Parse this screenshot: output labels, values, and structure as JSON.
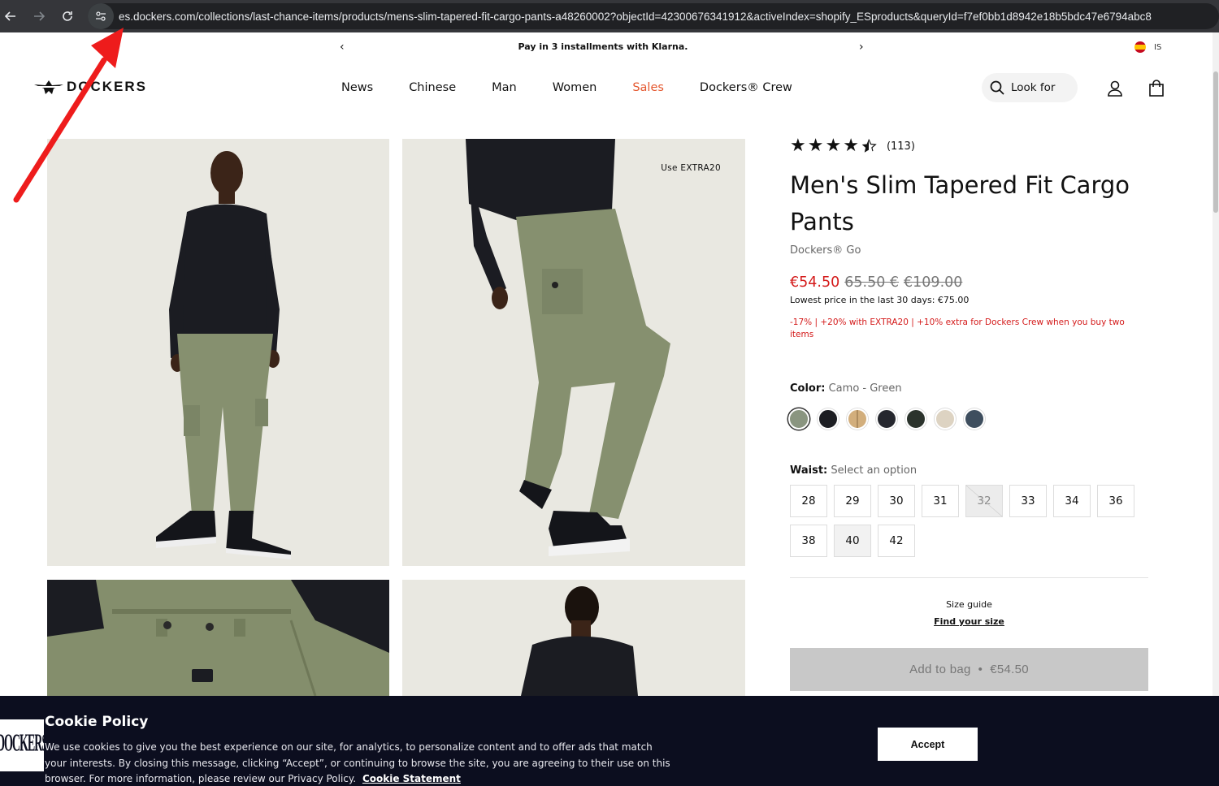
{
  "browser": {
    "back_icon": "arrow-left-icon",
    "forward_icon": "arrow-right-icon",
    "reload_icon": "reload-icon",
    "url": "es.dockers.com/collections/last-chance-items/products/mens-slim-tapered-fit-cargo-pants-a48260002?objectId=42300676341912&activeIndex=shopify_ESproducts&queryId=f7ef0bb1d8942e18b5bdc47e6794abc8"
  },
  "promo": {
    "prev": "‹",
    "text": "Pay in 3 installments with Klarna.",
    "next": "›",
    "lang": "IS"
  },
  "header": {
    "logo_text": "DOCKERS",
    "nav": [
      "News",
      "Chinese",
      "Man",
      "Women",
      "Sales",
      "Dockers® Crew"
    ],
    "search_label": "Look for"
  },
  "gallery": {
    "badge": "Use EXTRA20"
  },
  "product": {
    "rating": 4.5,
    "review_count": "(113)",
    "title": "Men's Slim Tapered Fit Cargo Pants",
    "sub_brand": "Dockers® Go",
    "price_now": "€54.50",
    "price_prev": "65.50 €",
    "price_orig": "€109.00",
    "lowest_price": "Lowest price in the last 30 days: €75.00",
    "promo_note": "-17% | +20% with EXTRA20 | +10% extra for Dockers Crew when you buy two items",
    "color_label": "Color:",
    "color_value": "Camo - Green",
    "colors": [
      "#8a9580",
      "#1c1d22",
      "#c9a675",
      "#25272e",
      "#2b332c",
      "#ddd3c2",
      "#3e4e5e"
    ],
    "waist_label": "Waist:",
    "waist_value": "Select an option",
    "sizes": [
      "28",
      "29",
      "30",
      "31",
      "32",
      "33",
      "34",
      "36",
      "38",
      "40",
      "42"
    ],
    "size_guide": "Size guide",
    "find_size": "Find your size",
    "add_to_bag": "Add to bag",
    "add_sep": "•",
    "add_price": "€54.50"
  },
  "cookie": {
    "logo_text": "DOCKERS",
    "title": "Cookie Policy",
    "body": "We use cookies to give you the best experience on our site, for analytics, to personalize content and to offer ads that match your interests. By closing this message, clicking “Accept”, or continuing to browse the site, you are agreeing to their use on this browser. For more information, please review our Privacy Policy.",
    "link": "Cookie Statement",
    "accept": "Accept"
  },
  "colors": {
    "sale_accent": "#e4572e",
    "price_red": "#d41a1a",
    "cookie_bg": "#0c0e1f",
    "annotation": "#ee1c1c"
  }
}
